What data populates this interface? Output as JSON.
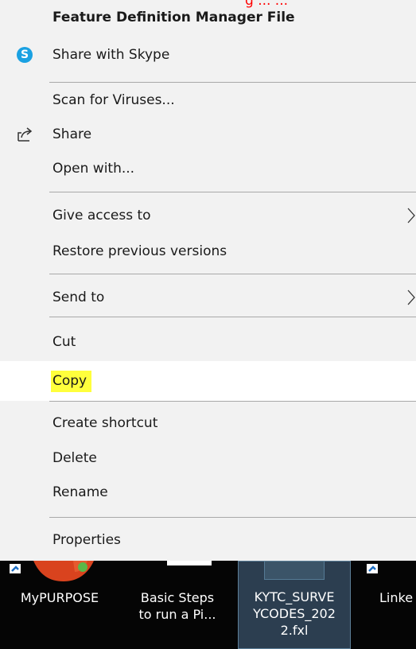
{
  "menu": {
    "overflow_text": "g      ... ... ",
    "header": "Feature Definition Manager File",
    "items": [
      {
        "label": "Share with Skype",
        "icon": "skype-icon"
      },
      {
        "label": "Scan for Viruses..."
      },
      {
        "label": "Share",
        "icon": "share-icon"
      },
      {
        "label": "Open with..."
      },
      {
        "label": "Give access to",
        "submenu": true
      },
      {
        "label": "Restore previous versions"
      },
      {
        "label": "Send to",
        "submenu": true
      },
      {
        "label": "Cut"
      },
      {
        "label": "Copy",
        "highlighted": true
      },
      {
        "label": "Create shortcut"
      },
      {
        "label": "Delete"
      },
      {
        "label": "Rename"
      },
      {
        "label": "Properties"
      }
    ]
  },
  "desktop": {
    "icons": [
      {
        "line1": "MyPURPOSE",
        "line2": ""
      },
      {
        "line1": "Basic Steps",
        "line2": "to run a Pi..."
      },
      {
        "line1": "KYTC_SURVE",
        "line2": "YCODES_202",
        "line3": "2.fxl",
        "selected": true
      },
      {
        "line1": "Linke",
        "line2": ""
      }
    ]
  },
  "colors": {
    "menu_bg": "#f2f2f2",
    "highlight": "#ffff3c",
    "desktop_bg": "#050505",
    "selected_tile": "#2c3e50"
  }
}
